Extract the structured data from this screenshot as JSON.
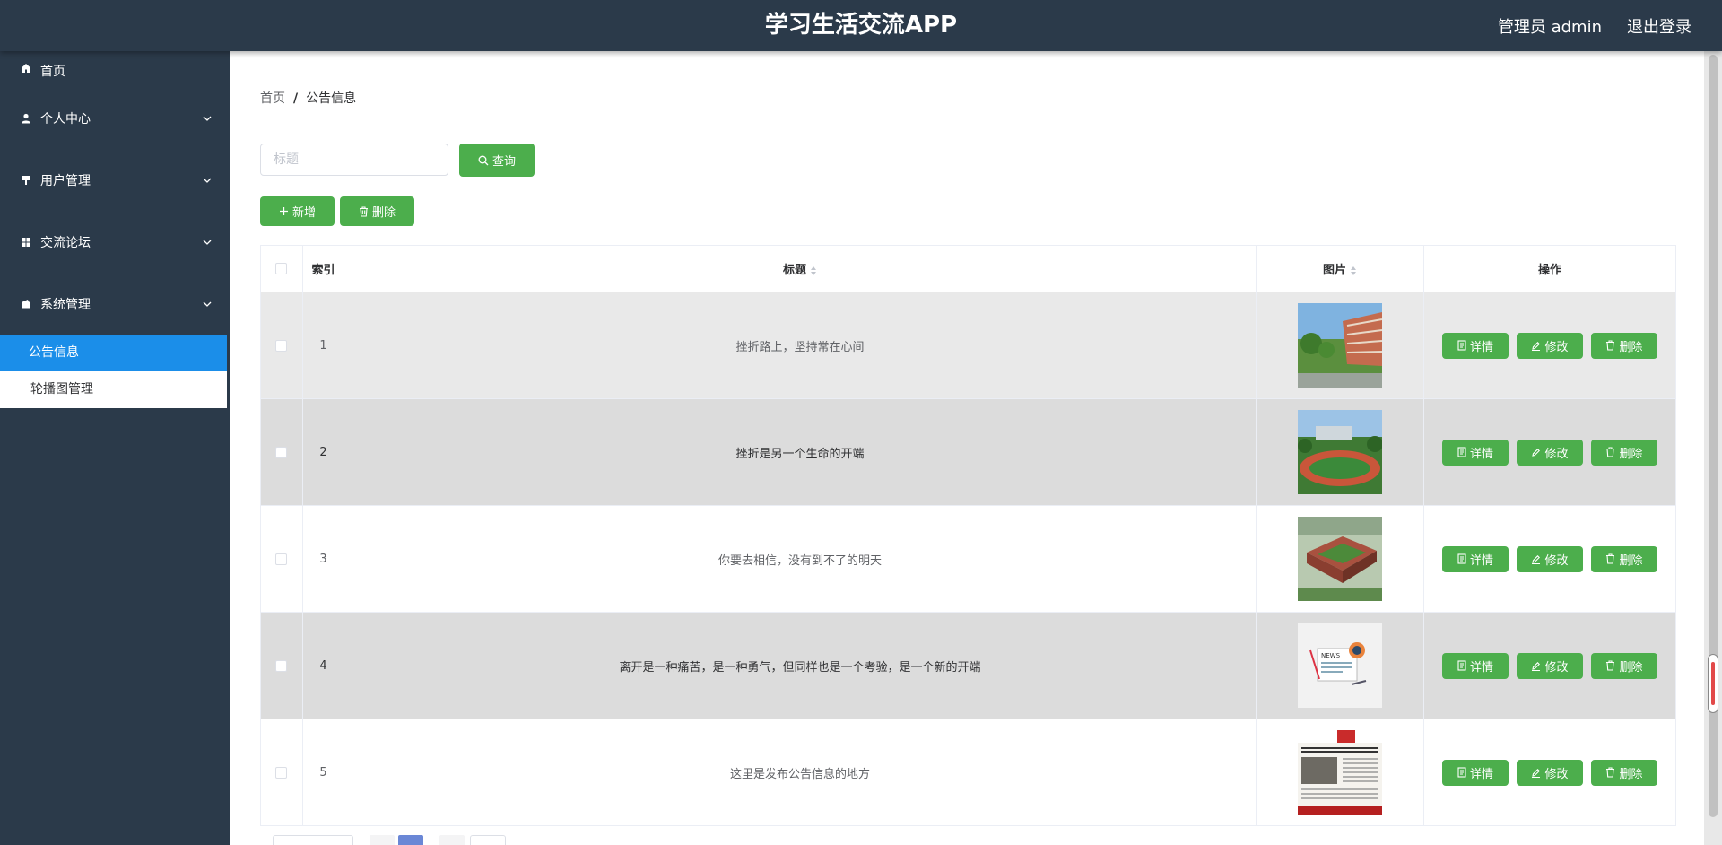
{
  "header": {
    "title": "学习生活交流APP",
    "user_label": "管理员 admin",
    "logout_label": "退出登录"
  },
  "sidebar": {
    "items": [
      {
        "label": "首页",
        "icon": "home-icon"
      },
      {
        "label": "个人中心",
        "icon": "user-icon"
      },
      {
        "label": "用户管理",
        "icon": "users-manage-icon"
      },
      {
        "label": "交流论坛",
        "icon": "grid-icon"
      },
      {
        "label": "系统管理",
        "icon": "wallet-icon"
      }
    ],
    "submenu": [
      {
        "label": "公告信息",
        "active": true
      },
      {
        "label": "轮播图管理",
        "active": false
      }
    ]
  },
  "breadcrumb": {
    "home": "首页",
    "separator": "/",
    "current": "公告信息"
  },
  "search": {
    "placeholder": "标题",
    "value": "",
    "query_label": "查询"
  },
  "toolbar": {
    "add_label": "新增",
    "delete_label": "删除"
  },
  "table": {
    "headers": {
      "index": "索引",
      "title": "标题",
      "image": "图片",
      "actions": "操作"
    },
    "rows": [
      {
        "index": "1",
        "title": "挫折路上，坚持常在心间",
        "image": "campus-building-photo"
      },
      {
        "index": "2",
        "title": "挫折是另一个生命的开端",
        "image": "sports-field-photo"
      },
      {
        "index": "3",
        "title": "你要去相信，没有到不了的明天",
        "image": "campus-aerial-photo"
      },
      {
        "index": "4",
        "title": "离开是一种痛苦，是一种勇气，但同样也是一个考验，是一个新的开端",
        "image": "news-illustration"
      },
      {
        "index": "5",
        "title": "这里是发布公告信息的地方",
        "image": "newspaper-photo"
      }
    ],
    "action_labels": {
      "detail": "详情",
      "edit": "修改",
      "delete": "删除"
    }
  },
  "colors": {
    "header_bg": "#2b3a4a",
    "accent_green": "#4cae4c",
    "active_blue": "#1b8ee9"
  }
}
